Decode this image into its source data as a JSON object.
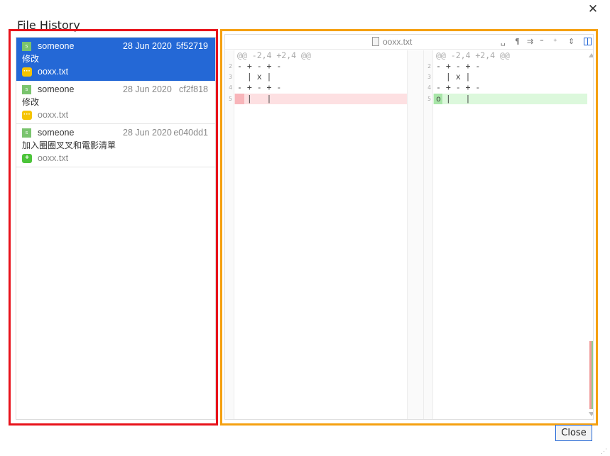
{
  "dialog": {
    "title": "File History",
    "close_label": "Close"
  },
  "commits": [
    {
      "author": "someone",
      "avatar": "s",
      "date": "28 Jun 2020",
      "hash": "5f52719",
      "message": "修改",
      "file": "ooxx.txt",
      "change": "modified"
    },
    {
      "author": "someone",
      "avatar": "s",
      "date": "28 Jun 2020",
      "hash": "cf2f818",
      "message": "修改",
      "file": "ooxx.txt",
      "change": "modified"
    },
    {
      "author": "someone",
      "avatar": "s",
      "date": "28 Jun 2020",
      "hash": "e040dd1",
      "message": "加入圈圈叉叉和電影清單",
      "file": "ooxx.txt",
      "change": "added"
    }
  ],
  "diff": {
    "file_name": "ooxx.txt",
    "hunk_header": "@@ -2,4 +2,4 @@",
    "left_lines": [
      {
        "num": "2",
        "text": "- + - + -"
      },
      {
        "num": "3",
        "text": "  | x |"
      },
      {
        "num": "4",
        "text": "- + - + -"
      },
      {
        "num": "5",
        "text": "  |   |"
      }
    ],
    "right_lines": [
      {
        "num": "2",
        "text": "- + - + -"
      },
      {
        "num": "3",
        "text": "  | x |"
      },
      {
        "num": "4",
        "text": "- + - + -"
      },
      {
        "num": "5",
        "text": "o |   |"
      }
    ]
  },
  "colors": {
    "selected": "#2468d6",
    "deleted": "#fde0e2",
    "added": "#dcf8dc",
    "left_highlight": "#e8121a",
    "right_highlight": "#f5a010"
  }
}
